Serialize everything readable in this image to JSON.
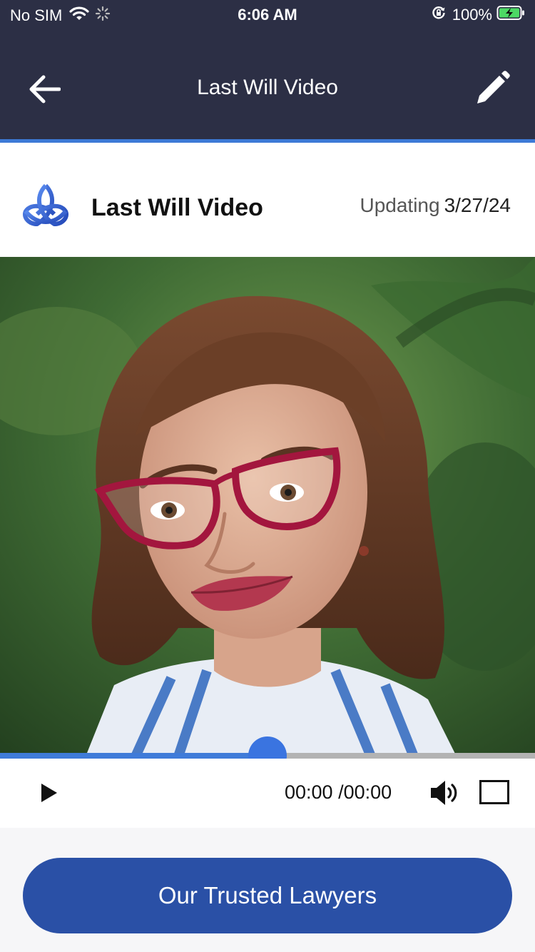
{
  "status_bar": {
    "carrier": "No SIM",
    "time": "6:06 AM",
    "battery_percent": "100%",
    "icons": [
      "wifi-icon",
      "loading-spinner-icon",
      "orientation-lock-icon",
      "battery-charging-icon"
    ]
  },
  "nav": {
    "title": "Last Will Video",
    "back_icon": "arrow-left-icon",
    "edit_icon": "pencil-icon"
  },
  "header": {
    "logo_icon": "triquetra-logo-icon",
    "title": "Last Will Video",
    "updating_label": "Updating",
    "date": "3/27/24"
  },
  "video": {
    "thumbnail": "portrait-photo",
    "progress_fraction": 0.5,
    "current_time": "00:00",
    "separator": "/",
    "total_time": "00:00",
    "play_icon": "play-icon",
    "volume_icon": "volume-icon",
    "fullscreen_icon": "fullscreen-icon"
  },
  "footer": {
    "cta_label": "Our Trusted Lawyers"
  },
  "colors": {
    "nav_background": "#2c2f45",
    "accent": "#3d7ad6",
    "cta_background": "#2a50a6",
    "progress_knob": "#3a74e0"
  }
}
